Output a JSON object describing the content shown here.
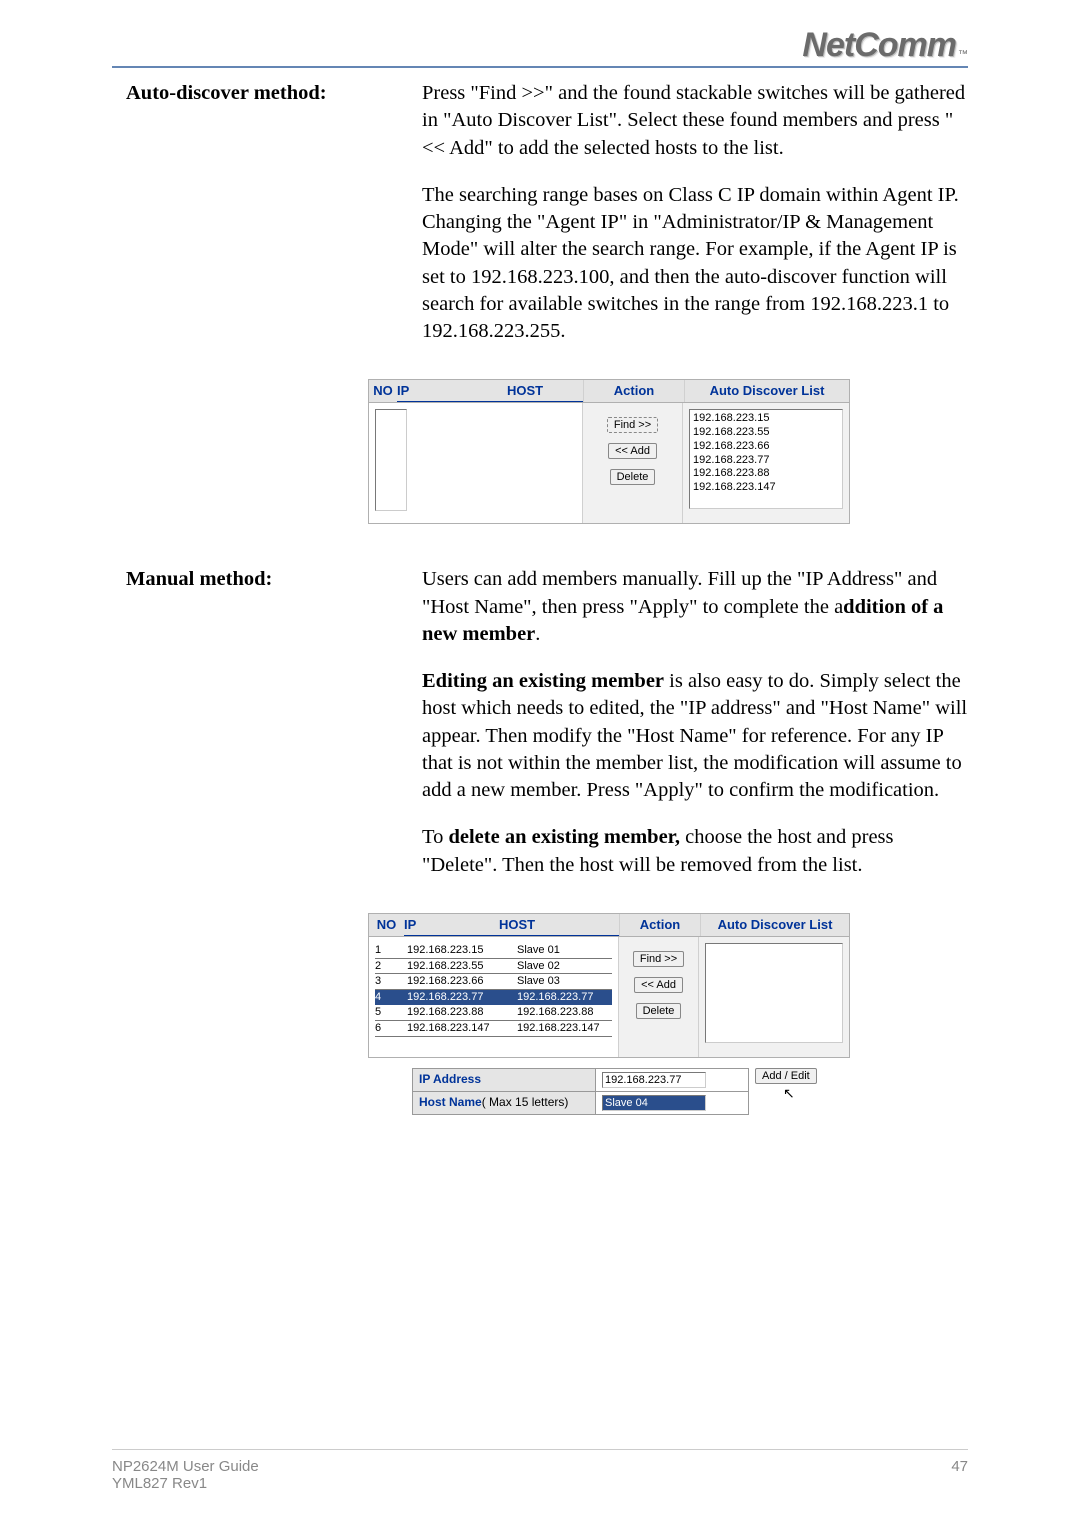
{
  "logo": {
    "text": "NetComm",
    "tm": "™"
  },
  "section1": {
    "heading": "Auto-discover method:",
    "para1": "Press \"Find >>\" and the found stackable switches will be gathered in \"Auto Discover List\". Select these found members and press \" << Add\" to add the selected hosts to the list.",
    "para2": "The searching range bases on Class C IP domain within Agent IP.  Changing the \"Agent IP\" in \"Administrator/IP & Management Mode\" will alter the search range.  For example, if the Agent IP is set to 192.168.223.100, and then the auto-discover function will search for available switches in the range from 192.168.223.1 to 192.168.223.255."
  },
  "figure1": {
    "cols": {
      "no": "NO",
      "ip": "IP",
      "host": "HOST",
      "action": "Action",
      "discover": "Auto Discover List"
    },
    "buttons": {
      "find": "Find >>",
      "add": "<< Add",
      "delete": "Delete"
    },
    "discover_list": [
      "192.168.223.15",
      "192.168.223.55",
      "192.168.223.66",
      "192.168.223.77",
      "192.168.223.88",
      "192.168.223.147"
    ]
  },
  "section2": {
    "heading": "Manual method:",
    "para1_a": "Users can add members manually.  Fill up the \"IP Address\" and \"Host Name\", then press \"Apply\" to complete the a",
    "para1_b": "ddition of a new member",
    "para1_c": ".",
    "para2_a": "Editing an existing member",
    "para2_b": " is also easy to do. Simply select the host which needs to edited, the \"IP address\" and \"Host Name\" will appear.  Then modify the \"Host Name\" for reference.  For any IP that is not within the member list, the modification will assume to add a new member. Press \"Apply\" to confirm the modification.",
    "para3_a": "To ",
    "para3_b": "delete an existing member,",
    "para3_c": " choose the host and press \"Delete\".  Then the host will be removed from the list."
  },
  "figure2": {
    "cols": {
      "no": "NO",
      "ip": "IP",
      "host": "HOST",
      "action": "Action",
      "discover": "Auto Discover List"
    },
    "buttons": {
      "find": "Find >>",
      "add": "<< Add",
      "delete": "Delete"
    },
    "members": [
      {
        "no": "1",
        "ip": "192.168.223.15",
        "host": "Slave 01",
        "selected": false
      },
      {
        "no": "2",
        "ip": "192.168.223.55",
        "host": "Slave 02",
        "selected": false
      },
      {
        "no": "3",
        "ip": "192.168.223.66",
        "host": "Slave 03",
        "selected": false
      },
      {
        "no": "4",
        "ip": "192.168.223.77",
        "host": "192.168.223.77",
        "selected": true
      },
      {
        "no": "5",
        "ip": "192.168.223.88",
        "host": "192.168.223.88",
        "selected": false
      },
      {
        "no": "6",
        "ip": "192.168.223.147",
        "host": "192.168.223.147",
        "selected": false
      }
    ]
  },
  "form": {
    "ip_label": "IP Address",
    "ip_value": "192.168.223.77",
    "hostname_label": "Host Name",
    "hostname_hint": "( Max 15 letters)",
    "hostname_value": "Slave 04",
    "button": "Add / Edit"
  },
  "footer": {
    "left1": "NP2624M User Guide",
    "left2": "YML827 Rev1",
    "right": "47"
  }
}
